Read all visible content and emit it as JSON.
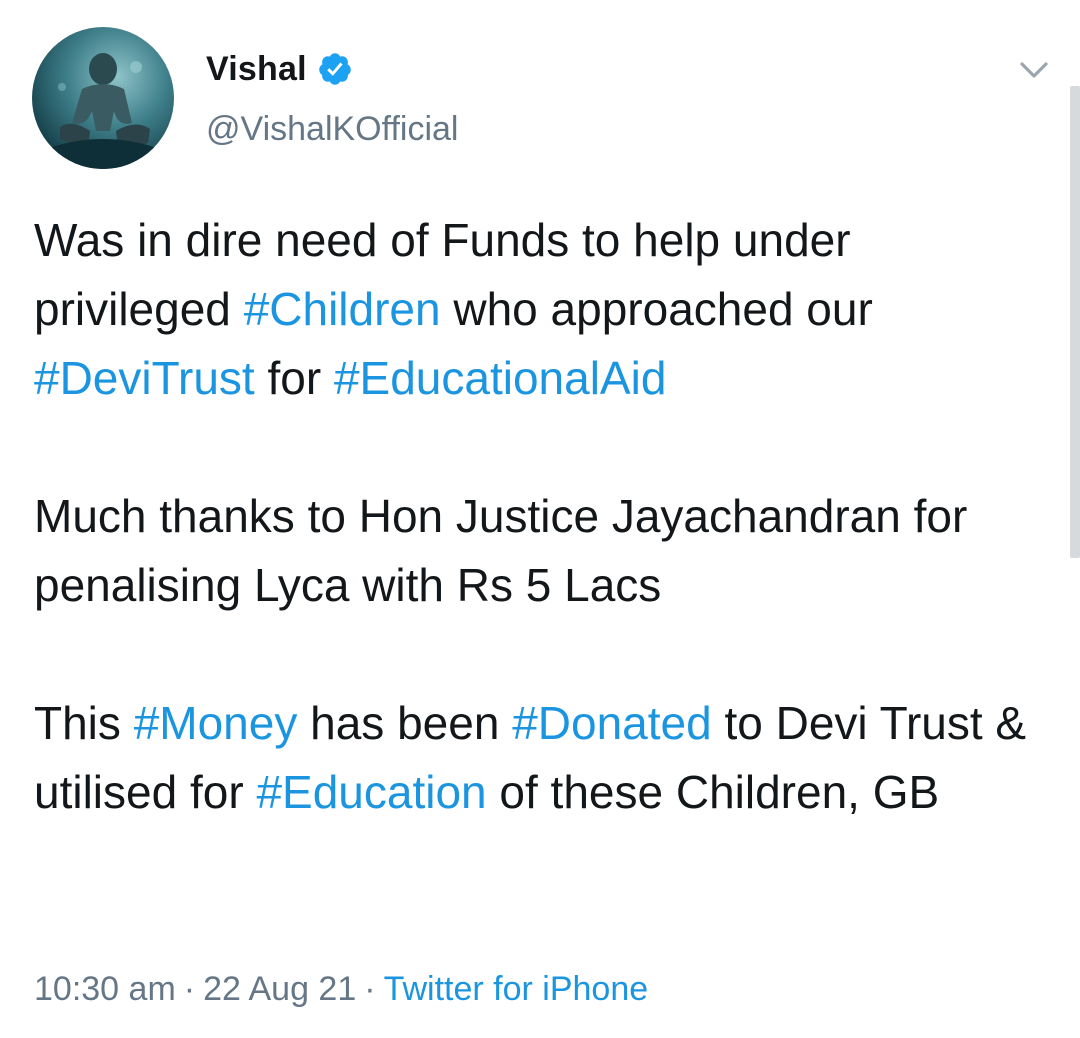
{
  "author": {
    "name": "Vishal",
    "handle": "@VishalKOfficial",
    "verified_icon": "verified-badge-icon"
  },
  "tweet": {
    "p1": {
      "t1": "Was in dire need of Funds to help under privileged ",
      "h1": "#Children",
      "t2": " who approached our ",
      "h2": "#DeviTrust",
      "t3": " for ",
      "h3": "#EducationalAid"
    },
    "p2": {
      "t1": "Much thanks to Hon Justice Jayachandran for penalising Lyca with Rs 5 Lacs"
    },
    "p3": {
      "t1": "This ",
      "h1": "#Money",
      "t2": " has been ",
      "h2": "#Donated",
      "t3": " to Devi Trust & utilised for ",
      "h3": "#Education",
      "t4": " of these Children, GB"
    }
  },
  "meta": {
    "time": "10:30 am",
    "date": "22 Aug 21",
    "separator": "·",
    "source": "Twitter for iPhone"
  },
  "colors": {
    "hashtag": "#1b95e0",
    "secondary_text": "#657786",
    "primary_text": "#14171a",
    "verified": "#1da1f2"
  }
}
